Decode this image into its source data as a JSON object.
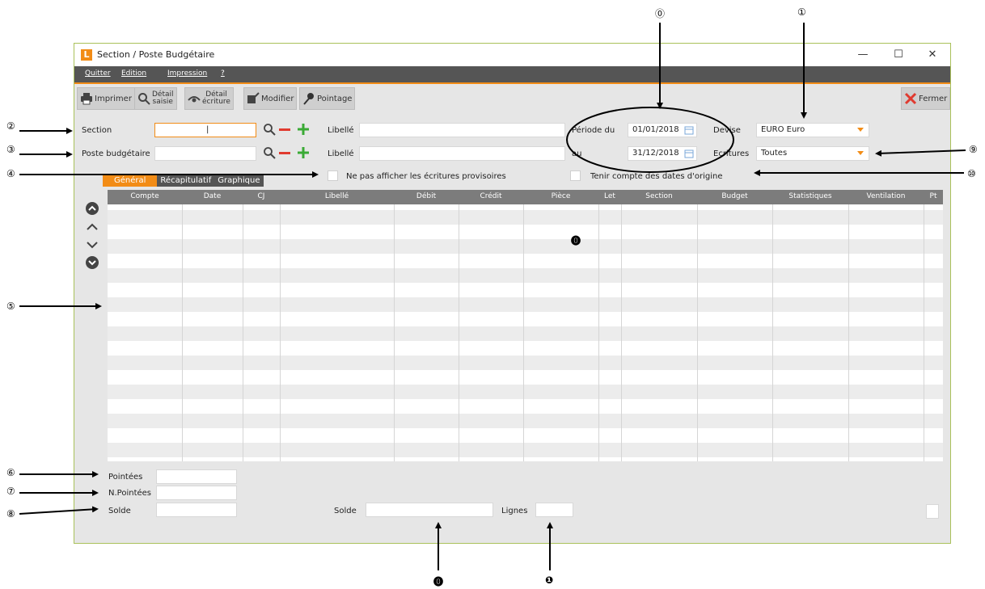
{
  "window": {
    "title": "Section / Poste Budgétaire",
    "logo_letter": "L",
    "minimize": "—",
    "maximize": "☐",
    "close": "✕"
  },
  "menu": [
    "Quitter",
    "Edition",
    "Impression",
    "?"
  ],
  "toolbar": {
    "print": "Imprimer",
    "detail_saisie_1": "Détail",
    "detail_saisie_2": "saisie",
    "detail_ecriture_1": "Détail",
    "detail_ecriture_2": "écriture",
    "modify": "Modifier",
    "pointage": "Pointage",
    "close": "Fermer"
  },
  "form": {
    "section_label": "Section",
    "section_value": "|",
    "poste_label": "Poste budgétaire",
    "poste_value": "",
    "libelle1_label": "Libellé",
    "libelle2_label": "Libellé",
    "periode_label": "Période du",
    "date_from": "01/01/2018",
    "au_label": "au",
    "date_to": "31/12/2018",
    "devise_label": "Devise",
    "devise_value": "EURO Euro",
    "ecritures_label": "Ecritures",
    "ecritures_value": "Toutes",
    "chk_provisoires": "Ne pas afficher les écritures provisoires",
    "chk_dates": "Tenir compte des dates d'origine"
  },
  "tabs": [
    "Général",
    "Récapitulatif",
    "Graphique"
  ],
  "grid": {
    "columns": [
      "Compte",
      "Date",
      "CJ",
      "Libellé",
      "Débit",
      "Crédit",
      "Pièce",
      "Let",
      "Section",
      "Budget",
      "Statistiques",
      "Ventilation",
      "Pt"
    ]
  },
  "footer": {
    "pointees": "Pointées",
    "npointees": "N.Pointées",
    "solde1": "Solde",
    "solde2": "Solde",
    "lignes": "Lignes"
  },
  "annotations": {
    "a0": "⓪",
    "a1": "①",
    "a2": "②",
    "a3": "③",
    "a4": "④",
    "a5": "⑤",
    "a6": "⑥",
    "a7": "⑦",
    "a8": "⑧",
    "a9": "⑨",
    "a10": "⑩",
    "grid_mark": "⓿",
    "bottom_1": "⓿",
    "bottom_2": "❶"
  },
  "colors": {
    "accent": "#f28c16",
    "menubar": "#555555",
    "close_red": "#e03a2f",
    "green": "#3aaa35"
  }
}
